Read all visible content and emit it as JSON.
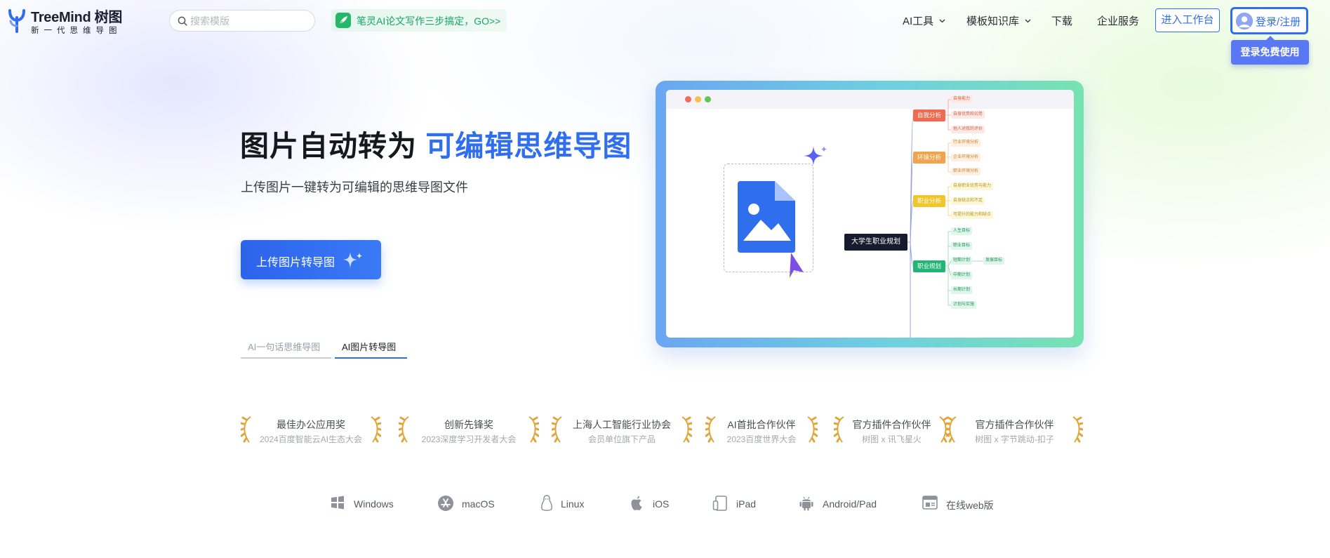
{
  "brand": {
    "name": "TreeMind 树图",
    "tagline": "新一代思维导图"
  },
  "search": {
    "placeholder": "搜索模版",
    "value": ""
  },
  "promo": {
    "text": "笔灵AI论文写作三步搞定，GO>>"
  },
  "nav": {
    "items": [
      {
        "label": "AI工具",
        "dropdown": true
      },
      {
        "label": "模板知识库",
        "dropdown": true
      },
      {
        "label": "下载",
        "dropdown": false
      },
      {
        "label": "企业服务",
        "dropdown": false
      }
    ],
    "workbench_label": "进入工作台",
    "login_label": "登录/注册",
    "tooltip": "登录免费使用"
  },
  "hero": {
    "title_plain": "图片自动转为",
    "title_highlight": "可编辑思维导图",
    "subtitle": "上传图片一键转为可编辑的思维导图文件",
    "cta_label": "上传图片转导图",
    "tabs": [
      {
        "label": "AI一句话思维导图",
        "active": false
      },
      {
        "label": "AI图片转导图",
        "active": true
      }
    ]
  },
  "mindmap": {
    "root": "大学生职业规划",
    "branches": [
      {
        "label": "自我分析",
        "color": "#ef6a4f",
        "leaves": [
          "自身能力",
          "自身优势和劣势",
          "他人对我的评价"
        ]
      },
      {
        "label": "环境分析",
        "color": "#f2a44c",
        "leaves": [
          "行业环境分析",
          "企业环境分析",
          "职业环境分析"
        ]
      },
      {
        "label": "职业分析",
        "color": "#f1c62b",
        "leaves": [
          "自身职业优势与能力",
          "自身缺点和不足",
          "可提升的能力和缺点"
        ]
      },
      {
        "label": "职业规划",
        "color": "#21b674",
        "leaves": [
          "人生目标",
          "职业目标",
          "短期计划",
          "中期计划",
          "长期计划",
          "计划与实施"
        ],
        "extra_leaf": "发展目标"
      }
    ]
  },
  "awards": [
    {
      "title": "最佳办公应用奖",
      "sub": "2024百度智能云AI生态大会"
    },
    {
      "title": "创新先锋奖",
      "sub": "2023深度学习开发者大会"
    },
    {
      "title": "上海人工智能行业协会",
      "sub": "会员单位旗下产品"
    },
    {
      "title": "AI首批合作伙伴",
      "sub": "2023百度世界大会"
    },
    {
      "title": "官方插件合作伙伴",
      "sub": "树图 x 讯飞星火"
    },
    {
      "title": "官方插件合作伙伴",
      "sub": "树图 x 字节跳动-扣子"
    }
  ],
  "platforms": [
    {
      "label": "Windows",
      "icon": "windows-icon"
    },
    {
      "label": "macOS",
      "icon": "app-store-icon"
    },
    {
      "label": "Linux",
      "icon": "linux-icon"
    },
    {
      "label": "iOS",
      "icon": "apple-icon"
    },
    {
      "label": "iPad",
      "icon": "tablet-icon"
    },
    {
      "label": "Android/Pad",
      "icon": "android-icon"
    },
    {
      "label": "在线web版",
      "icon": "browser-icon"
    }
  ],
  "colors": {
    "accent": "#2f6fed",
    "promo_green": "#17a566",
    "laurel_gold": "#e1a63b",
    "tooltip_bg": "#5b78f4"
  }
}
